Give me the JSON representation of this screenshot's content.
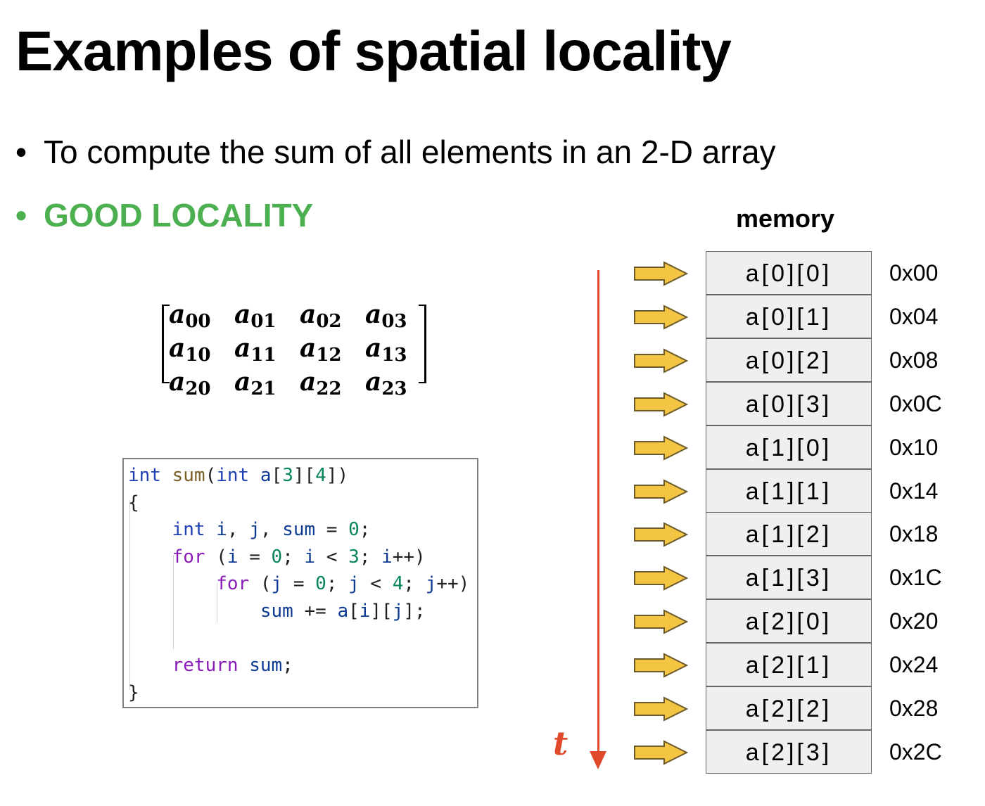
{
  "title": "Examples of spatial locality",
  "bullets": [
    {
      "symbol": "•",
      "text": "To compute the sum of all elements in an 2-D array"
    },
    {
      "symbol": "•",
      "text": "GOOD LOCALITY"
    }
  ],
  "colors": {
    "good_locality": "#4caf50",
    "timeline": "#e04a2a",
    "arrow_fill": "#f4c542",
    "arrow_stroke": "#6b5a2b",
    "cell_fill": "#efefef"
  },
  "matrix": {
    "base": "a",
    "rows": [
      [
        "00",
        "01",
        "02",
        "03"
      ],
      [
        "10",
        "11",
        "12",
        "13"
      ],
      [
        "20",
        "21",
        "22",
        "23"
      ]
    ]
  },
  "code": {
    "lines": [
      "int sum(int a[3][4])",
      "{",
      "    int i, j, sum = 0;",
      "    for (i = 0; i < 3; i++)",
      "        for (j = 0; j < 4; j++)",
      "            sum += a[i][j];",
      "",
      "    return sum;",
      "}"
    ]
  },
  "memory": {
    "header": "memory",
    "time_label": "t",
    "arrow_icon": "right-arrow-icon",
    "cells": [
      {
        "label": "a[0][0]",
        "address": "0x00"
      },
      {
        "label": "a[0][1]",
        "address": "0x04"
      },
      {
        "label": "a[0][2]",
        "address": "0x08"
      },
      {
        "label": "a[0][3]",
        "address": "0x0C"
      },
      {
        "label": "a[1][0]",
        "address": "0x10"
      },
      {
        "label": "a[1][1]",
        "address": "0x14"
      },
      {
        "label": "a[1][2]",
        "address": "0x18"
      },
      {
        "label": "a[1][3]",
        "address": "0x1C"
      },
      {
        "label": "a[2][0]",
        "address": "0x20"
      },
      {
        "label": "a[2][1]",
        "address": "0x24"
      },
      {
        "label": "a[2][2]",
        "address": "0x28"
      },
      {
        "label": "a[2][3]",
        "address": "0x2C"
      }
    ]
  }
}
